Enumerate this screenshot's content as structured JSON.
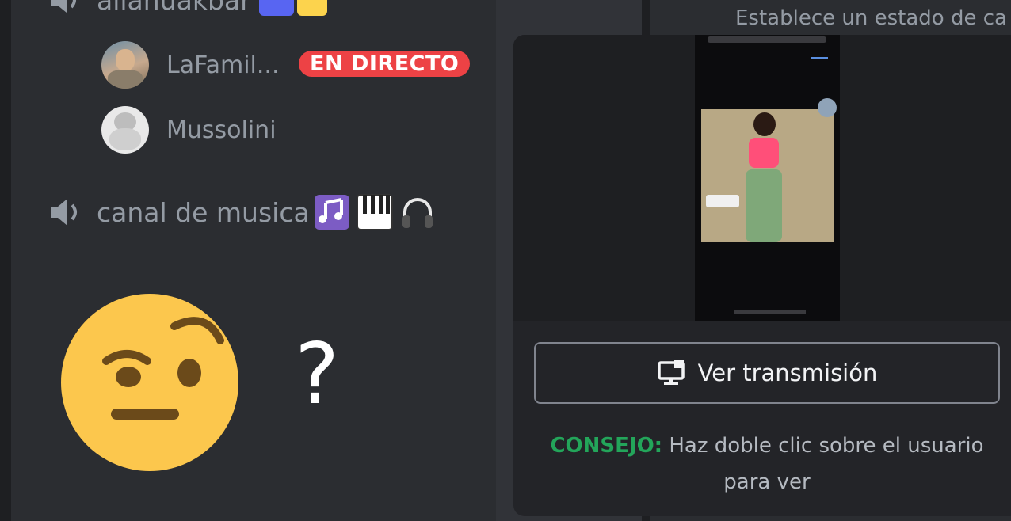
{
  "channels": {
    "top": {
      "name": "allahuakbar"
    },
    "music": {
      "name": "canal de musica"
    }
  },
  "users": [
    {
      "name": "LaFamil...",
      "badge": "EN DIRECTO"
    },
    {
      "name": "Mussolini"
    }
  ],
  "right_panel": {
    "status_text": "Establece un estado de ca"
  },
  "stream_popup": {
    "watch_button": "Ver transmisión",
    "tip_label": "CONSEJO:",
    "tip_text": " Haz doble clic sobre el usuario para ver"
  },
  "reaction": {
    "emoji": "face-with-raised-eyebrow-icon",
    "text": "?"
  },
  "colors": {
    "live_badge": "#ed4245",
    "tip_label": "#23a55a",
    "sidebar_bg": "#2b2d31",
    "popup_bg": "#232428"
  }
}
